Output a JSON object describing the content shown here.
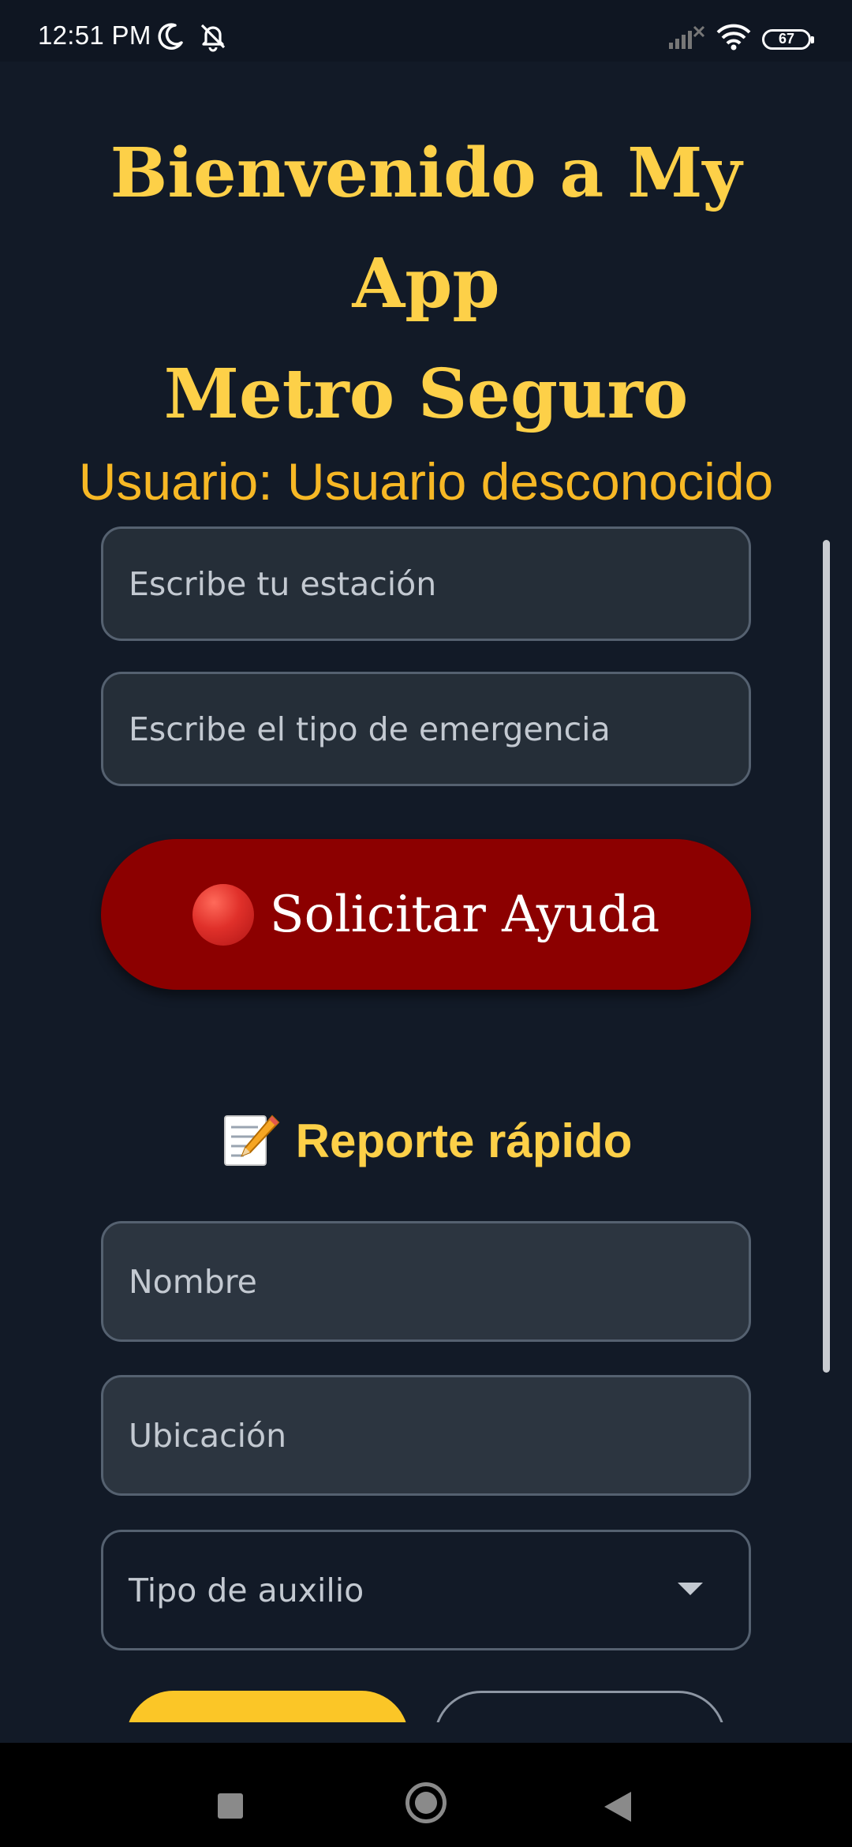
{
  "status_bar": {
    "time": "12:51 PM",
    "battery": "67",
    "icons": [
      "moon-icon",
      "bell-off-icon",
      "signal-x-icon",
      "wifi-icon",
      "battery-icon"
    ]
  },
  "header": {
    "title_line1": "Bienvenido a My",
    "title_line2": "App",
    "title_line3": "Metro Seguro",
    "user_label": "Usuario: Usuario desconocido"
  },
  "emergency_form": {
    "station_placeholder": "Escribe tu estación",
    "emergency_type_placeholder": "Escribe el tipo de emergencia",
    "help_button_label": "Solicitar Ayuda",
    "help_button_icon": "red-circle-icon"
  },
  "quick_report": {
    "title": "Reporte rápido",
    "title_icon": "memo-icon",
    "name_placeholder": "Nombre",
    "location_placeholder": "Ubicación",
    "aid_type_placeholder": "Tipo de auxilio"
  },
  "nav_bar": {
    "icons": [
      "recents-square-icon",
      "home-circle-icon",
      "back-triangle-icon"
    ]
  },
  "colors": {
    "background": "#121a27",
    "title_yellow": "#fdd048",
    "user_orange": "#f7b825",
    "help_red": "#8c0000",
    "primary_yellow": "#fbc627"
  }
}
